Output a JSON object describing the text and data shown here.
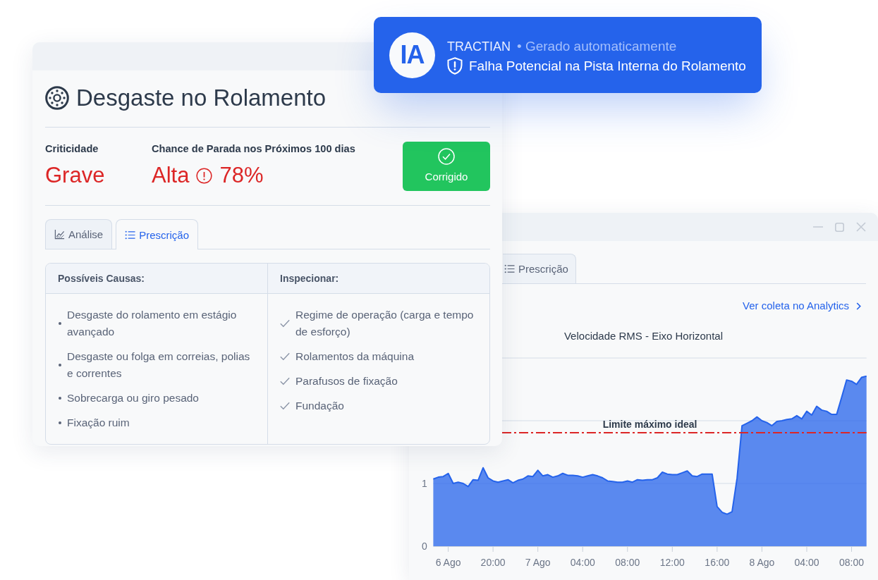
{
  "notification": {
    "logo_text": "IA",
    "source": "TRACTIAN",
    "subtitle": "• Gerado automaticamente",
    "message": "Falha Potencial na Pista Interna do Rolamento"
  },
  "insight_card": {
    "title": "Desgaste no Rolamento",
    "criticality": {
      "label": "Criticidade",
      "value": "Grave"
    },
    "stop_chance": {
      "label": "Chance de Parada nos Próximos 100 dias",
      "rating": "Alta",
      "percent": "78%"
    },
    "status_button": {
      "label": "Corrigido"
    },
    "tabs": [
      {
        "label": "Análise",
        "kind": "chart",
        "selected": false
      },
      {
        "label": "Prescrição",
        "kind": "list",
        "selected": true
      }
    ],
    "prescription_table": {
      "columns": [
        {
          "title": "Possíveis Causas:",
          "kind": "bullet",
          "items": [
            "Desgaste do rolamento em estágio avançado",
            "Desgaste ou folga em correias, polias e correntes",
            "Sobrecarga ou giro pesado",
            "Fixação ruim"
          ]
        },
        {
          "title": "Inspecionar:",
          "kind": "check",
          "items": [
            "Regime de operação (carga e tempo de esforço)",
            "Rolamentos da máquina",
            "Parafusos de fixação",
            "Fundação"
          ]
        }
      ]
    }
  },
  "analysis_window": {
    "tabs": [
      {
        "label": "Prescrição",
        "kind": "list",
        "selected": false
      }
    ],
    "link": "Ver coleta no Analytics",
    "chart": {
      "chart_data": {
        "type": "area",
        "title": "Velocidade RMS - Eixo Horizontal",
        "categories": [
          null,
          null,
          null,
          "6 Ago",
          null,
          null,
          null,
          null,
          null,
          null,
          null,
          null,
          "20:00",
          null,
          null,
          null,
          null,
          null,
          null,
          null,
          null,
          "7 Ago",
          null,
          null,
          null,
          null,
          null,
          null,
          null,
          null,
          "04:00",
          null,
          null,
          null,
          null,
          null,
          null,
          null,
          null,
          "08:00",
          null,
          null,
          null,
          null,
          null,
          null,
          null,
          null,
          "12:00",
          null,
          null,
          null,
          null,
          null,
          null,
          null,
          null,
          "16:00",
          null,
          null,
          null,
          null,
          null,
          null,
          null,
          null,
          "8 Ago",
          null,
          null,
          null,
          null,
          null,
          null,
          null,
          null,
          "04:00",
          null,
          null,
          null,
          null,
          null,
          null,
          null,
          null,
          "08:00",
          null,
          null,
          null
        ],
        "series": [
          {
            "color": "#2563eb",
            "values": [
              1.07,
              1.1,
              1.11,
              1.16,
              1.0,
              1.02,
              1.0,
              0.95,
              1.06,
              1.05,
              1.25,
              1.09,
              1.04,
              1.02,
              1.04,
              1.06,
              1.01,
              1.05,
              1.07,
              1.12,
              1.11,
              1.21,
              1.12,
              1.14,
              1.1,
              1.12,
              1.16,
              1.13,
              1.13,
              1.12,
              1.1,
              1.12,
              1.14,
              1.12,
              1.09,
              1.04,
              1.03,
              1.02,
              1.02,
              1.04,
              1.02,
              1.06,
              1.05,
              1.06,
              1.06,
              1.09,
              1.18,
              1.15,
              1.14,
              1.14,
              1.17,
              1.2,
              1.12,
              1.11,
              1.15,
              1.15,
              1.15,
              0.63,
              0.54,
              0.51,
              0.55,
              1.08,
              1.92,
              1.96,
              2.0,
              2.06,
              2.0,
              1.97,
              1.92,
              1.99,
              2.0,
              2.02,
              2.03,
              2.08,
              2.03,
              2.15,
              2.09,
              2.23,
              2.17,
              2.15,
              2.1,
              2.1,
              2.37,
              2.65,
              2.63,
              2.58,
              2.69,
              2.71
            ]
          }
        ],
        "ylim": [
          0,
          3
        ],
        "yticks": [
          0,
          1
        ],
        "ref_lines": [
          {
            "axis": "y",
            "value": 1.81,
            "label": "Limite máximo ideal",
            "color": "#dc2626"
          }
        ]
      }
    }
  }
}
